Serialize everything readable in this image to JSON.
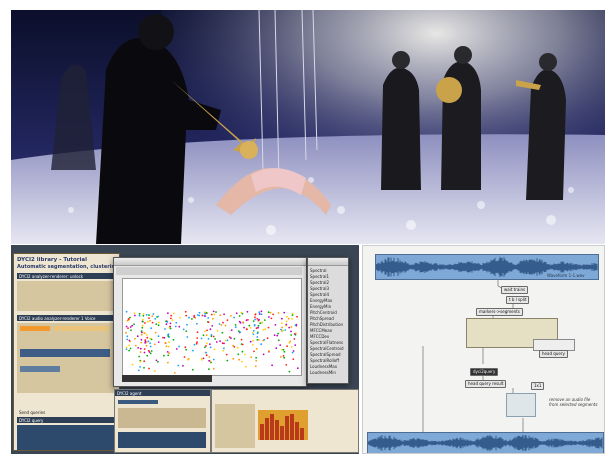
{
  "collage": {
    "doc_title": "DYCI2 library - Tutorial",
    "doc_subtitle": "Automatic segmentation, clustering, and labelling",
    "panel1_title": "DYCI2 analyzer-renderer: unlock",
    "panel2_title": "DYCI2 audio analyzer-renderer 1 Voice",
    "send_queries_label": "Send queries",
    "query_header": "DYCI2 query",
    "agent_header": "DYCI2 agent",
    "list_items": [
      "Spectral",
      "Spectral1",
      "Spectral2",
      "Spectral3",
      "Spectral4",
      "EnergyMax",
      "EnergyMin",
      "PitchCentroid",
      "PitchSpread",
      "PitchDistribution",
      "MFCCMean",
      "MFCCDev",
      "SpectralFlatness",
      "SpectralCentroid",
      "SpectralSpread",
      "SpectralRolloff",
      "LoudnessMax",
      "LoudnessMin"
    ],
    "colors": {
      "accent": "#ff9a00",
      "plot_bg": "#ffffff",
      "window_bg": "#e8e8e8"
    }
  },
  "patch": {
    "file_label": "Waveform 1-1.wav",
    "nodes": {
      "wait_trains": "wait trains",
      "split": "t b l split",
      "markers_label": "markers->segments",
      "dyci2query": "dyci2query",
      "head_query": "head query",
      "head_query_result": "head query result",
      "mix": "1x1",
      "remove_note": "remove an audio file from selected segments"
    }
  }
}
